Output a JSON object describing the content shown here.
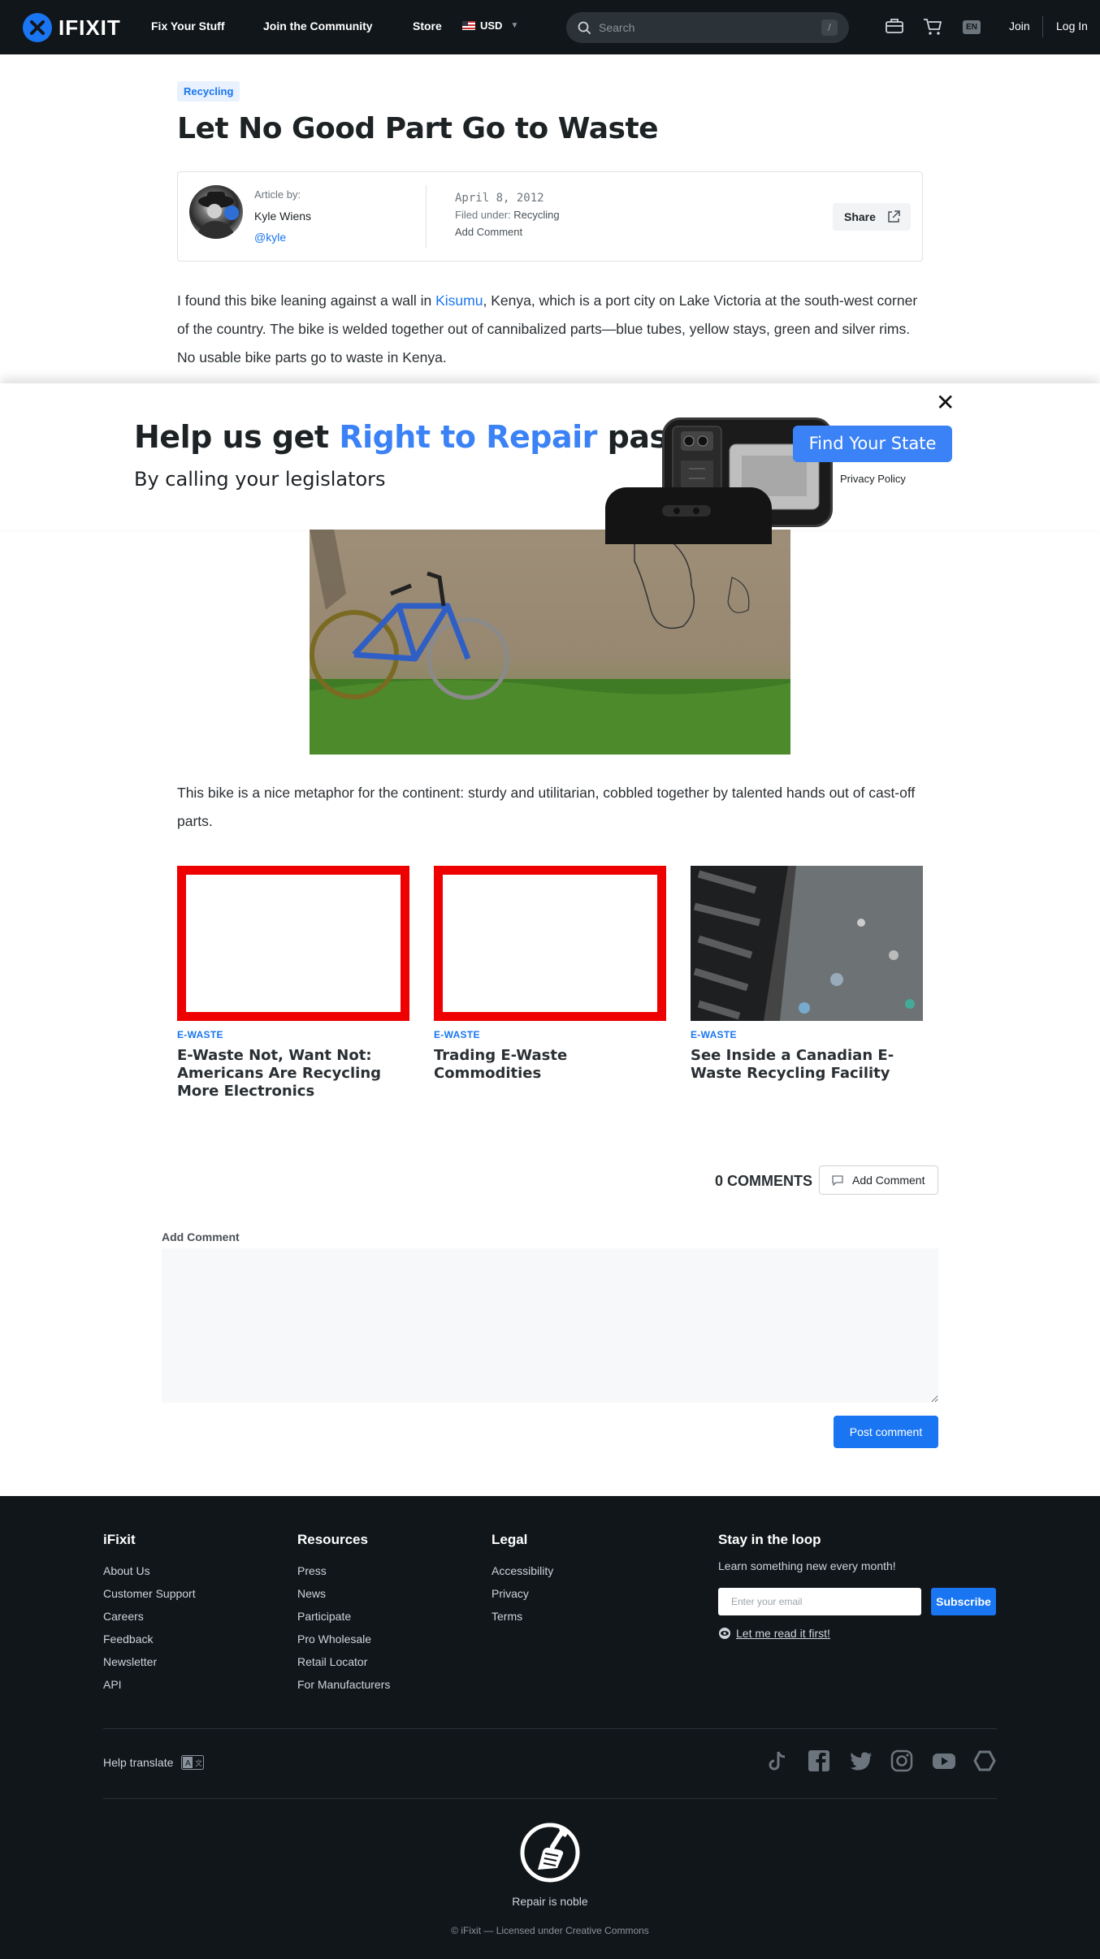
{
  "nav": {
    "brand": "IFIXIT",
    "links": [
      "Fix Your Stuff",
      "Join the Community",
      "Store"
    ],
    "currency": "USD",
    "search_placeholder": "Search",
    "search_shortcut": "/",
    "language": "EN",
    "join": "Join",
    "login": "Log In"
  },
  "article": {
    "tag": "Recycling",
    "title": "Let No Good Part Go to Waste",
    "author_label": "Article by:",
    "author_name": "Kyle Wiens",
    "author_handle": "@kyle",
    "date": "April 8, 2012",
    "filed_label": "Filed under:",
    "filed_value": "Recycling",
    "add_comment": "Add Comment",
    "share": "Share",
    "para1_a": "I found this bike leaning against a wall in ",
    "para1_link": "Kisumu",
    "para1_b": ", Kenya, which is a port city on Lake Victoria at the south-west corner of the country. The bike is welded together out of cannibalized parts—blue tubes, yellow stays, green and silver rims. No usable bike parts go to waste in Kenya.",
    "para2": "This bike is a nice metaphor for the continent: sturdy and utilitarian, cobbled together by talented hands out of cast-off parts."
  },
  "banner": {
    "title_a": "Help us get ",
    "title_hl": "Right to Repair",
    "title_b": " passed",
    "subtitle": "By calling your legislators",
    "cta": "Find Your State",
    "privacy": "Privacy Policy",
    "close": "✕"
  },
  "related": [
    {
      "category": "E-WASTE",
      "title": "E-Waste Not, Want Not: Americans Are Recycling More Electronics"
    },
    {
      "category": "E-WASTE",
      "title": "Trading E-Waste Commodities"
    },
    {
      "category": "E-WASTE",
      "title": "See Inside a Canadian E-Waste Recycling Facility"
    }
  ],
  "comments": {
    "count_label": "0 COMMENTS",
    "add_button": "Add Comment",
    "form_label": "Add Comment",
    "post_button": "Post comment"
  },
  "footer": {
    "col1": {
      "heading": "iFixit",
      "links": [
        "About Us",
        "Customer Support",
        "Careers",
        "Feedback",
        "Newsletter",
        "API"
      ]
    },
    "col2": {
      "heading": "Resources",
      "links": [
        "Press",
        "News",
        "Participate",
        "Pro Wholesale",
        "Retail Locator",
        "For Manufacturers"
      ]
    },
    "col3": {
      "heading": "Legal",
      "links": [
        "Accessibility",
        "Privacy",
        "Terms"
      ]
    },
    "newsletter": {
      "heading": "Stay in the loop",
      "text": "Learn something new every month!",
      "placeholder": "Enter your email",
      "button": "Subscribe",
      "read_link": "Let me read it first!"
    },
    "help_translate": "Help translate",
    "tagline": "Repair is noble",
    "license": "© iFixit — Licensed under Creative Commons"
  },
  "colors": {
    "brand_blue": "#1975f1",
    "promo_blue": "#3b82f6",
    "nav_bg": "#11161a",
    "related_frame": "#ee0000"
  }
}
